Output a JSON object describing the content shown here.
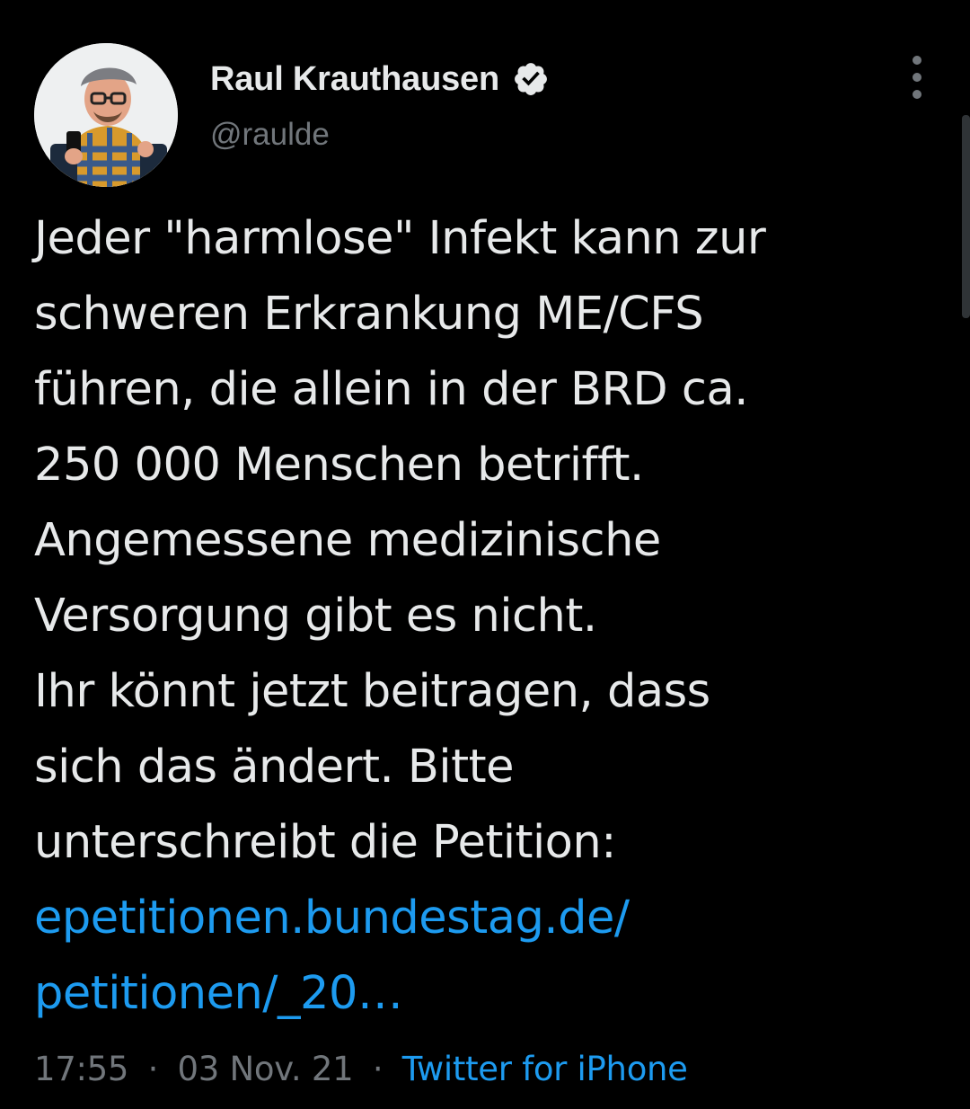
{
  "author": {
    "name": "Raul Krauthausen",
    "handle": "@raulde"
  },
  "tweet": {
    "lines": [
      "Jeder \"harmlose\" Infekt kann zur",
      "schweren Erkrankung ME/CFS",
      "führen, die allein in der BRD ca.",
      "250 000 Menschen betrifft.",
      "Angemessene medizinische",
      "Versorgung gibt es nicht.",
      "Ihr könnt jetzt beitragen, dass",
      "sich das ändert. Bitte",
      "unterschreibt die Petition:"
    ],
    "link_lines": [
      "epetitionen.bundestag.de/",
      "petitionen/_20…"
    ]
  },
  "meta": {
    "time": "17:55",
    "separator": "·",
    "date": "03 Nov. 21",
    "source": "Twitter for iPhone"
  },
  "colors": {
    "background": "#000000",
    "text": "#e7e9ea",
    "secondary": "#71767b",
    "link": "#1d9bf0"
  },
  "icons": {
    "verified": "verified-badge-icon",
    "more": "more-options-icon"
  }
}
